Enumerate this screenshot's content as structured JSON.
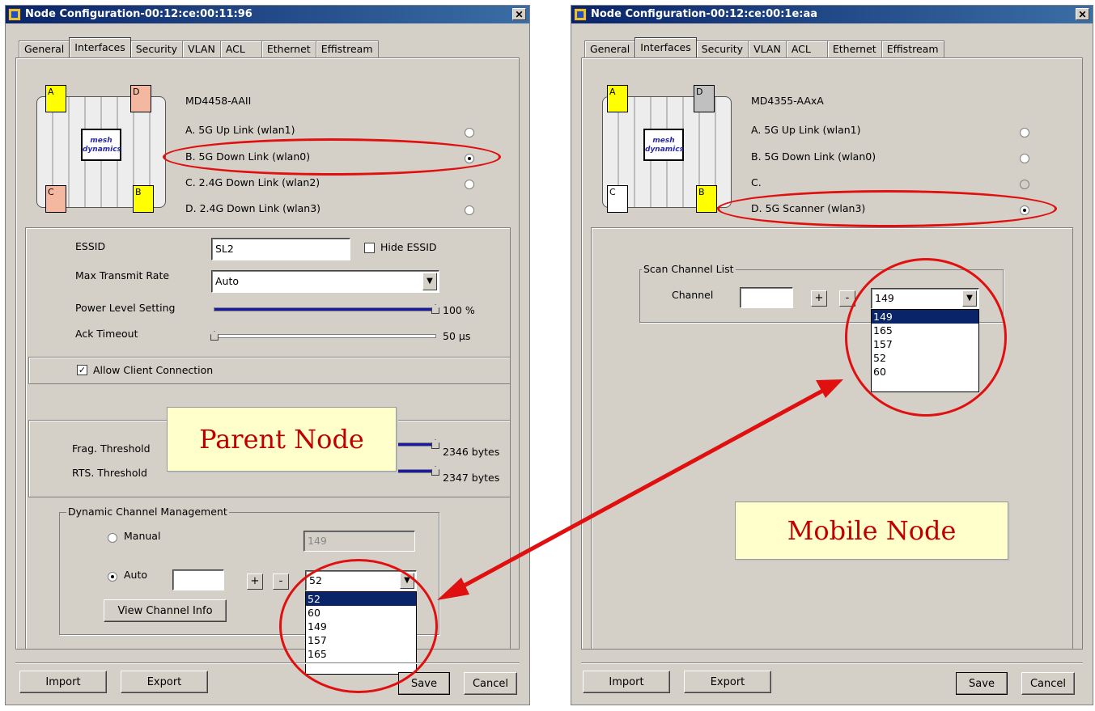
{
  "left_window": {
    "title": "Node Configuration-00:12:ce:00:11:96",
    "close_label": "✕",
    "tabs": [
      "General",
      "Interfaces",
      "Security",
      "VLAN",
      "ACL",
      "Ethernet",
      "Effistream"
    ],
    "active_tab": "Interfaces",
    "model": "MD4458-AAII",
    "ports": {
      "a": "A",
      "b": "B",
      "c": "C",
      "d": "D"
    },
    "logo_text": "mesh dynamics",
    "interfaces": [
      {
        "label": "A. 5G  Up Link (wlan1)",
        "selected": false
      },
      {
        "label": "B. 5G  Down Link (wlan0)",
        "selected": true
      },
      {
        "label": "C. 2.4G  Down Link (wlan2)",
        "selected": false
      },
      {
        "label": "D. 2.4G  Down Link (wlan3)",
        "selected": false
      }
    ],
    "essid_label": "ESSID",
    "essid_value": "SL2",
    "hide_essid_label": "Hide ESSID",
    "max_rate_label": "Max Transmit Rate",
    "max_rate_value": "Auto",
    "power_label": "Power Level Setting",
    "power_value": "100 %",
    "power_fraction": 1.0,
    "ack_label": "Ack Timeout",
    "ack_value": "50 µs",
    "ack_fraction": 0.0,
    "allow_client_label": "Allow Client Connection",
    "frag_label": "Frag. Threshold",
    "frag_value": "2346 bytes",
    "rts_label": "RTS. Threshold",
    "rts_value": "2347 bytes",
    "dcm_legend": "Dynamic Channel Management",
    "manual_label": "Manual",
    "manual_value": "149",
    "auto_label": "Auto",
    "plus": "+",
    "minus": "-",
    "dropdown_value": "52",
    "dropdown_arrow": "▼",
    "channel_options": [
      "52",
      "60",
      "149",
      "157",
      "165"
    ],
    "view_channel_label": "View Channel Info",
    "import_label": "Import",
    "export_label": "Export",
    "save_label": "Save",
    "cancel_label": "Cancel"
  },
  "right_window": {
    "title": "Node Configuration-00:12:ce:00:1e:aa",
    "close_label": "✕",
    "tabs": [
      "General",
      "Interfaces",
      "Security",
      "VLAN",
      "ACL",
      "Ethernet",
      "Effistream"
    ],
    "active_tab": "Interfaces",
    "model": "MD4355-AAxA",
    "ports": {
      "a": "A",
      "b": "B",
      "c": "C",
      "d": "D"
    },
    "logo_text": "mesh dynamics",
    "interfaces": [
      {
        "label": "A. 5G  Up Link (wlan1)",
        "selected": false
      },
      {
        "label": "B. 5G  Down Link (wlan0)",
        "selected": false
      },
      {
        "label": "C.",
        "selected": false
      },
      {
        "label": "D. 5G  Scanner (wlan3)",
        "selected": true
      }
    ],
    "scan_legend": "Scan Channel List",
    "channel_label": "Channel",
    "plus": "+",
    "minus": "-",
    "dropdown_value": "149",
    "dropdown_arrow": "▼",
    "channel_options": [
      "149",
      "165",
      "157",
      "52",
      "60"
    ],
    "import_label": "Import",
    "export_label": "Export",
    "save_label": "Save",
    "cancel_label": "Cancel"
  },
  "annotations": {
    "parent_node": "Parent Node",
    "mobile_node": "Mobile Node",
    "highlight_color": "#e01010"
  }
}
